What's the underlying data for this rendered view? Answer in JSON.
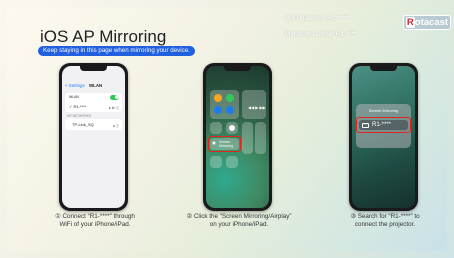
{
  "title": "iOS AP Mirroring",
  "banner": "Keep staying in this page when mirroring your device.",
  "wifi_network": "WiFi Network:  R1-****",
  "mirroring_device": "Mirroring Device:  R1-****",
  "logo": {
    "prefix": "R",
    "rest": "otacast"
  },
  "phone1": {
    "back": "< Settings",
    "screen_title": "WLAN",
    "wlan_label": "WLAN",
    "connected": "✓ R1-****",
    "section_label": "MY NETWORKS",
    "other_network": "TP-Link_SQ"
  },
  "phone2": {
    "mirror_label_line1": "Screen",
    "mirror_label_line2": "Mirroring"
  },
  "phone3": {
    "popup_title": "Screen Mirroring",
    "device": "R1-****"
  },
  "steps": [
    {
      "line1": "① Connect “R1-****” through",
      "line2": "WiFi of your iPhone/iPad."
    },
    {
      "line1": "② Click the “Screen Mirroring/Airplay”",
      "line2": "on your iPhone/iPad."
    },
    {
      "line1": "③ Search for “R1-****” to",
      "line2": "connect the projector."
    }
  ]
}
